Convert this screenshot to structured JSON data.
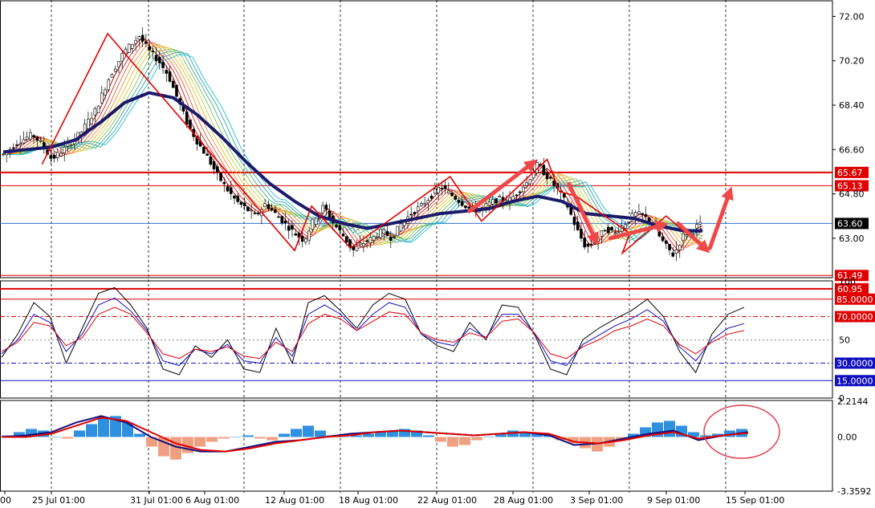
{
  "chart_data": [
    {
      "panel": "price",
      "type": "candlestick",
      "ylim": [
        61.4,
        72.6
      ],
      "yticks": [
        "72.00",
        "70.20",
        "68.40",
        "66.60",
        "64.80",
        "63.00"
      ],
      "price_marker": {
        "label": "63.60",
        "value": 63.6,
        "color": "#000000"
      },
      "levels": [
        {
          "label": "65.67",
          "value": 65.67,
          "color": "#e00000",
          "width": 2
        },
        {
          "label": "65.13",
          "value": 65.13,
          "color": "#e00000",
          "width": 1
        },
        {
          "label": "61.49",
          "value": 61.49,
          "color": "#e00000",
          "width": 1
        },
        {
          "label": "60.95",
          "value": 60.95,
          "color": "#e00000",
          "width": 2
        }
      ],
      "close_path": [
        [
          0,
          66.4
        ],
        [
          0.3,
          66.9
        ],
        [
          0.6,
          67.2
        ],
        [
          0.8,
          66.8
        ],
        [
          1.0,
          66.2
        ],
        [
          1.3,
          66.7
        ],
        [
          1.6,
          67.3
        ],
        [
          1.9,
          68.2
        ],
        [
          2.2,
          69.6
        ],
        [
          2.5,
          70.6
        ],
        [
          2.8,
          71.2
        ],
        [
          3.0,
          70.6
        ],
        [
          3.2,
          70.2
        ],
        [
          3.4,
          69.6
        ],
        [
          3.6,
          68.6
        ],
        [
          3.8,
          67.6
        ],
        [
          4.0,
          66.9
        ],
        [
          4.2,
          66.3
        ],
        [
          4.4,
          65.6
        ],
        [
          4.6,
          65.0
        ],
        [
          4.8,
          64.5
        ],
        [
          5.0,
          64.2
        ],
        [
          5.2,
          63.9
        ],
        [
          5.4,
          64.4
        ],
        [
          5.6,
          64.0
        ],
        [
          5.8,
          63.6
        ],
        [
          6.0,
          63.2
        ],
        [
          6.2,
          62.9
        ],
        [
          6.4,
          63.8
        ],
        [
          6.6,
          64.3
        ],
        [
          6.8,
          63.6
        ],
        [
          7.0,
          63.1
        ],
        [
          7.2,
          62.5
        ],
        [
          7.4,
          62.8
        ],
        [
          7.6,
          63.0
        ],
        [
          7.8,
          63.3
        ],
        [
          8.0,
          63.0
        ],
        [
          8.2,
          63.6
        ],
        [
          8.4,
          64.0
        ],
        [
          8.6,
          64.3
        ],
        [
          8.8,
          64.7
        ],
        [
          9.0,
          65.1
        ],
        [
          9.2,
          64.8
        ],
        [
          9.4,
          64.5
        ],
        [
          9.6,
          64.2
        ],
        [
          9.8,
          64.1
        ],
        [
          10.0,
          64.4
        ],
        [
          10.2,
          64.6
        ],
        [
          10.4,
          64.5
        ],
        [
          10.6,
          64.9
        ],
        [
          10.8,
          65.3
        ],
        [
          11.0,
          66.0
        ],
        [
          11.2,
          65.5
        ],
        [
          11.4,
          65.0
        ],
        [
          11.6,
          64.4
        ],
        [
          11.8,
          63.4
        ],
        [
          12.0,
          62.6
        ],
        [
          12.2,
          62.9
        ],
        [
          12.4,
          63.4
        ],
        [
          12.6,
          63.2
        ],
        [
          12.8,
          63.6
        ],
        [
          13.0,
          64.0
        ],
        [
          13.2,
          63.9
        ],
        [
          13.4,
          63.4
        ],
        [
          13.6,
          62.8
        ],
        [
          13.8,
          62.3
        ],
        [
          14.0,
          63.1
        ],
        [
          14.2,
          63.4
        ],
        [
          14.4,
          63.6
        ]
      ],
      "ma_points": [
        [
          0,
          66.5
        ],
        [
          1.0,
          66.7
        ],
        [
          1.5,
          67.0
        ],
        [
          2.0,
          67.7
        ],
        [
          2.5,
          68.5
        ],
        [
          3.0,
          68.9
        ],
        [
          3.5,
          68.7
        ],
        [
          4.0,
          68.0
        ],
        [
          4.5,
          67.1
        ],
        [
          5.0,
          66.1
        ],
        [
          5.5,
          65.2
        ],
        [
          6.0,
          64.5
        ],
        [
          6.5,
          63.9
        ],
        [
          7.0,
          63.6
        ],
        [
          7.5,
          63.4
        ],
        [
          8.0,
          63.6
        ],
        [
          8.5,
          63.8
        ],
        [
          9.0,
          64.0
        ],
        [
          9.5,
          64.1
        ],
        [
          10.0,
          64.2
        ],
        [
          10.5,
          64.5
        ],
        [
          11.0,
          64.7
        ],
        [
          11.5,
          64.5
        ],
        [
          12.0,
          64.0
        ],
        [
          12.5,
          63.9
        ],
        [
          13.0,
          63.8
        ],
        [
          13.5,
          63.5
        ],
        [
          14.0,
          63.3
        ],
        [
          14.4,
          63.3
        ]
      ],
      "trend_zigzag": [
        [
          0.8,
          66.0
        ],
        [
          2.15,
          71.3
        ],
        [
          6.0,
          62.5
        ],
        [
          6.35,
          64.3
        ],
        [
          7.15,
          62.6
        ],
        [
          9.2,
          65.5
        ],
        [
          9.85,
          63.7
        ],
        [
          11.2,
          66.2
        ],
        [
          11.45,
          64.9
        ],
        [
          11.8,
          64.7
        ],
        [
          12.9,
          63.2
        ],
        [
          12.75,
          62.4
        ],
        [
          13.65,
          63.9
        ],
        [
          14.25,
          62.9
        ]
      ],
      "arrows": [
        {
          "from": [
            9.6,
            64.1
          ],
          "to": [
            11.0,
            66.2
          ]
        },
        {
          "from": [
            11.65,
            65.2
          ],
          "to": [
            12.25,
            62.7
          ]
        },
        {
          "from": [
            12.5,
            63.0
          ],
          "to": [
            13.7,
            63.6
          ]
        },
        {
          "from": [
            13.9,
            63.6
          ],
          "to": [
            14.55,
            62.4
          ]
        },
        {
          "from": [
            14.55,
            62.6
          ],
          "to": [
            15.0,
            65.1
          ]
        }
      ]
    },
    {
      "panel": "stochastic",
      "type": "line",
      "ylim": [
        0,
        100
      ],
      "yticks": [
        "100",
        "50",
        "0"
      ],
      "levels": [
        {
          "label": "85.0000",
          "value": 85,
          "color": "#e00000",
          "style": "solid"
        },
        {
          "label": "70.0000",
          "value": 70,
          "color": "#e00000",
          "style": "dashdot"
        },
        {
          "label": "30.0000",
          "value": 30,
          "color": "#1010c0",
          "style": "dashdot"
        },
        {
          "label": "15.0000",
          "value": 15,
          "color": "#1010c0",
          "style": "solid"
        }
      ],
      "series": [
        {
          "color": "#000000",
          "values": [
            35,
            55,
            82,
            70,
            30,
            60,
            90,
            95,
            80,
            60,
            25,
            20,
            45,
            35,
            50,
            25,
            22,
            60,
            30,
            82,
            88,
            75,
            60,
            80,
            90,
            85,
            55,
            45,
            40,
            65,
            50,
            80,
            78,
            55,
            25,
            20,
            50,
            60,
            68,
            75,
            85,
            70,
            40,
            22,
            55,
            72,
            78
          ]
        },
        {
          "color": "#1010c0",
          "values": [
            38,
            50,
            72,
            65,
            40,
            55,
            80,
            86,
            75,
            58,
            32,
            28,
            42,
            38,
            46,
            32,
            30,
            52,
            36,
            72,
            80,
            72,
            58,
            72,
            82,
            78,
            55,
            48,
            45,
            60,
            52,
            72,
            72,
            56,
            32,
            28,
            46,
            54,
            62,
            68,
            76,
            66,
            44,
            32,
            50,
            60,
            64
          ]
        },
        {
          "color": "#e00000",
          "values": [
            40,
            48,
            65,
            62,
            45,
            52,
            72,
            78,
            72,
            56,
            38,
            34,
            42,
            40,
            44,
            36,
            34,
            48,
            40,
            64,
            72,
            68,
            58,
            66,
            74,
            72,
            56,
            50,
            48,
            56,
            52,
            66,
            68,
            56,
            38,
            34,
            44,
            50,
            58,
            62,
            68,
            62,
            46,
            38,
            48,
            55,
            58
          ]
        }
      ]
    },
    {
      "panel": "macd",
      "type": "bar",
      "ylim": [
        -3.3592,
        2.2144
      ],
      "yticks": [
        "2.2144",
        "0.00",
        "-3.3592"
      ],
      "histogram": [
        0.1,
        0.3,
        0.5,
        0.4,
        0.0,
        -0.1,
        0.4,
        0.8,
        1.2,
        1.3,
        0.9,
        0.2,
        -0.6,
        -1.2,
        -1.4,
        -1.0,
        -0.6,
        -0.3,
        -0.1,
        0.0,
        0.1,
        -0.1,
        -0.2,
        0.2,
        0.5,
        0.7,
        0.4,
        0.1,
        0.0,
        0.1,
        0.2,
        0.3,
        0.4,
        0.5,
        0.4,
        0.1,
        -0.3,
        -0.6,
        -0.5,
        -0.2,
        0.0,
        0.2,
        0.4,
        0.3,
        0.2,
        0.1,
        -0.2,
        -0.4,
        -0.7,
        -0.9,
        -0.6,
        -0.2,
        0.2,
        0.6,
        0.9,
        1.0,
        0.7,
        0.3,
        0.1,
        0.2,
        0.4,
        0.5
      ],
      "series": [
        {
          "color": "#101080",
          "values": [
            0.0,
            0.1,
            0.3,
            0.9,
            1.3,
            0.9,
            0.0,
            -0.6,
            -0.9,
            -0.9,
            -0.6,
            -0.3,
            -0.2,
            0.0,
            0.2,
            0.3,
            0.4,
            0.3,
            0.2,
            0.1,
            0.2,
            0.3,
            0.1,
            -0.5,
            -0.4,
            -0.1,
            0.2,
            0.4,
            -0.2,
            0.1,
            0.3
          ]
        },
        {
          "color": "#e00000",
          "values": [
            0.0,
            0.0,
            0.2,
            0.7,
            1.2,
            1.0,
            0.3,
            -0.4,
            -0.8,
            -0.9,
            -0.7,
            -0.4,
            -0.2,
            0.0,
            0.1,
            0.3,
            0.4,
            0.3,
            0.2,
            0.1,
            0.2,
            0.3,
            0.2,
            -0.3,
            -0.4,
            -0.2,
            0.1,
            0.3,
            -0.1,
            0.1,
            0.25
          ]
        }
      ],
      "annotation": "ellipse"
    }
  ],
  "x_labels": [
    "00",
    "25 Jul 01:00",
    "31 Jul 01:00",
    "6 Aug 01:00",
    "12 Aug 01:00",
    "18 Aug 01:00",
    "22 Aug 01:00",
    "28 Aug 01:00",
    "3 Sep 01:00",
    "9 Sep 01:00",
    "15 Sep 01:00"
  ]
}
